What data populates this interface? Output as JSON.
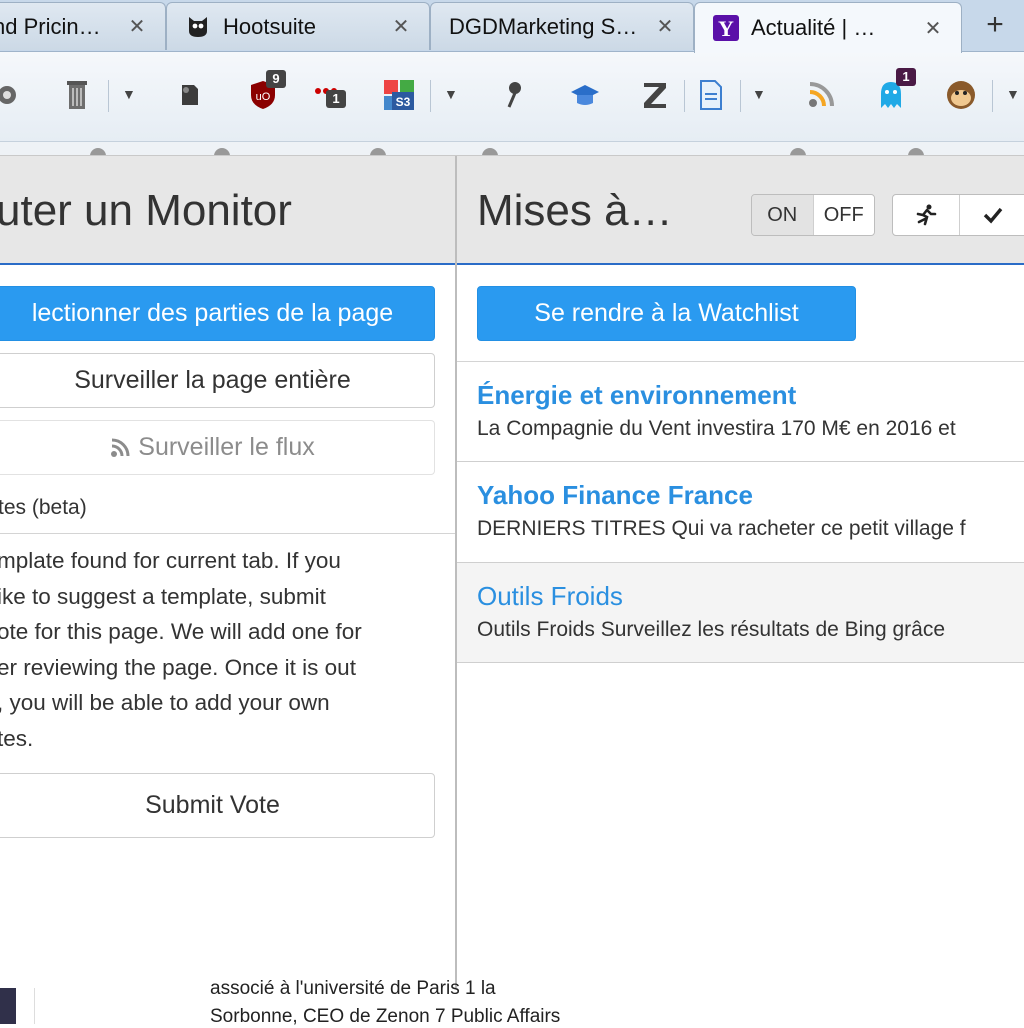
{
  "browser": {
    "tabs": [
      {
        "title": "nd Pricin…",
        "icon": "generic-page-icon"
      },
      {
        "title": "Hootsuite",
        "icon": "hootsuite-owl-icon"
      },
      {
        "title": "DGDMarketing S…",
        "icon": "generic-page-icon"
      },
      {
        "title": "Actualité | …",
        "icon": "yahoo-y-icon",
        "active": true
      }
    ],
    "tab_close_glyph": "✕",
    "new_tab_glyph": "+",
    "extension_badges": {
      "ublock": "9",
      "mail": "1",
      "ghostery": "1"
    },
    "toolbar_icons": [
      "puzzle-icon",
      "trash-icon",
      "evernote-icon",
      "ublock-icon",
      "mail-counter-icon",
      "s3-icon",
      "pin-icon",
      "graduation-cap-icon",
      "zotero-icon",
      "document-icon",
      "rss-icon",
      "ghostery-icon",
      "monkey-icon"
    ]
  },
  "left_panel": {
    "title": "uter un Monitor",
    "select_parts_label": "lectionner des parties de la page",
    "watch_page_label": "Surveiller la page entière",
    "watch_feed_label": "Surveiller le flux",
    "templates_label": "tes (beta)",
    "template_message_lines": [
      "mplate found for current tab. If you",
      "ike to suggest a template, submit",
      "ote for this page. We will add one for",
      "er reviewing the page. Once it is out",
      ", you will be able to add your own",
      "tes."
    ],
    "submit_vote_label": "Submit Vote"
  },
  "right_panel": {
    "title": "Mises à…",
    "toggle_on": "ON",
    "toggle_off": "OFF",
    "watchlist_label": "Se rendre à la Watchlist",
    "items": [
      {
        "title": "Énergie et environnement",
        "description": "La Compagnie du Vent investira 170 M€ en 2016 et",
        "bold": true
      },
      {
        "title": "Yahoo Finance France",
        "description": "DERNIERS TITRES Qui va racheter ce petit village f",
        "bold": true
      },
      {
        "title": "Outils Froids",
        "description": "Outils Froids Surveillez les résultats de Bing grâce",
        "bold": false
      }
    ]
  },
  "background_page": {
    "lines": [
      "associé à l'université de Paris 1 la",
      "Sorbonne, CEO de Zenon 7 Public Affairs"
    ]
  },
  "colors": {
    "accent": "#2a9af0",
    "link": "#2a8fe0",
    "header_border": "#2a6cc7"
  }
}
